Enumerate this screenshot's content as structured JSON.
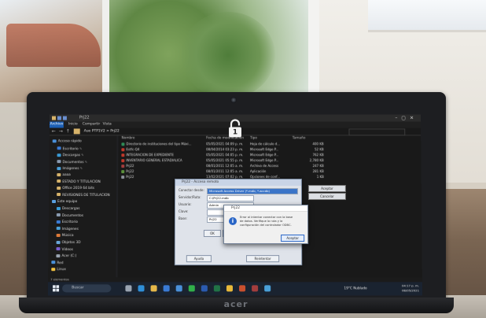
{
  "screen": {
    "window_title": "Prj22",
    "ribbon": {
      "file": "Archivo",
      "tabs": [
        "Inicio",
        "Compartir",
        "Vista"
      ]
    },
    "address_path": "Aue PTP1V2  >  Prj22",
    "nav_pane": [
      {
        "label": "Acceso rápido",
        "icon": "star-icon",
        "pinned": false
      },
      {
        "label": "Escritorio",
        "icon": "desktop-folder-icon",
        "pinned": true
      },
      {
        "label": "Descargas",
        "icon": "download-folder-icon",
        "pinned": true
      },
      {
        "label": "Documentos",
        "icon": "documents-folder-icon",
        "pinned": true
      },
      {
        "label": "Imágenes",
        "icon": "pictures-folder-icon",
        "pinned": true
      },
      {
        "label": "aaaa",
        "icon": "folder-icon",
        "pinned": false
      },
      {
        "label": "ESTADO Y TITULACION",
        "icon": "folder-icon",
        "pinned": false
      },
      {
        "label": "Office 2019 64 bits",
        "icon": "folder-icon",
        "pinned": false
      },
      {
        "label": "REVISIONES DE TITULACION",
        "icon": "folder-icon",
        "pinned": false
      },
      {
        "label": "Este equipo",
        "icon": "computer-icon",
        "pinned": false
      },
      {
        "label": "Descargas",
        "icon": "download-folder-icon",
        "pinned": false
      },
      {
        "label": "Documentos",
        "icon": "documents-folder-icon",
        "pinned": false
      },
      {
        "label": "Escritorio",
        "icon": "desktop-folder-icon",
        "pinned": false
      },
      {
        "label": "Imágenes",
        "icon": "pictures-folder-icon",
        "pinned": false
      },
      {
        "label": "Música",
        "icon": "music-folder-icon",
        "pinned": false
      },
      {
        "label": "Objetos 3D",
        "icon": "3d-objects-icon",
        "pinned": false
      },
      {
        "label": "Vídeos",
        "icon": "videos-folder-icon",
        "pinned": false
      },
      {
        "label": "Acer (C:)",
        "icon": "drive-icon",
        "pinned": false
      },
      {
        "label": "Red",
        "icon": "network-icon",
        "pinned": false
      },
      {
        "label": "Linux",
        "icon": "linux-icon",
        "pinned": false
      }
    ],
    "file_columns": [
      "Nombre",
      "Fecha de modificación",
      "Tipo",
      "Tamaño"
    ],
    "files": [
      {
        "name": "Directorio de instituciones del tipo Máxi...",
        "date": "05/05/2021 04:09 p. m.",
        "type": "Hoja de cálculo d...",
        "size": "400 KB",
        "icon_color": "#2e8b57"
      },
      {
        "name": "Estfc-Q4",
        "date": "08/04/2014 03:23 p. m.",
        "type": "Microsoft Edge P...",
        "size": "52 KB",
        "icon_color": "#c0392b"
      },
      {
        "name": "INTEGRACION DE EXPEDIENTE",
        "date": "05/05/2021 04:05 p. m.",
        "type": "Microsoft Edge P...",
        "size": "762 KB",
        "icon_color": "#c0392b"
      },
      {
        "name": "INVENTARIO GENERAL ESTADIALICA",
        "date": "05/05/2021 05:55 p. m.",
        "type": "Microsoft Edge P...",
        "size": "2,780 KB",
        "icon_color": "#c0392b"
      },
      {
        "name": "Prj22",
        "date": "08/01/2011 12:05 a. m.",
        "type": "Archivo de Access",
        "size": "247 KB",
        "icon_color": "#a33d3d"
      },
      {
        "name": "Prj22",
        "date": "08/01/2011 12:05 a. m.",
        "type": "Aplicación",
        "size": "281 KB",
        "icon_color": "#5a8f3a"
      },
      {
        "name": "Prj22",
        "date": "13/02/2021 07:02 p. m.",
        "type": "Opciones de conf...",
        "size": "1 KB",
        "icon_color": "#8a8f99"
      }
    ],
    "lock_label": "1",
    "main_dialog": {
      "title": "Prj22 - Acceso remoto",
      "rows": [
        {
          "label": "Conectar desde:",
          "value": "Microsoft Access Driver (*.mdb, *.accdb)"
        },
        {
          "label": "Servidor/Ruta:",
          "value": "C:\\Prj22.mdb"
        },
        {
          "label": "Usuario:",
          "value": "Admin"
        },
        {
          "label": "Clave:",
          "value": ""
        },
        {
          "label": "Base:",
          "value": "Prj22"
        }
      ],
      "buttons": [
        "OK",
        "Cancelar"
      ],
      "footer_buttons": [
        "Ayuda",
        "Reintentar"
      ]
    },
    "side_buttons": [
      "Aceptar",
      "Cancelar"
    ],
    "alert": {
      "title": "Prj22",
      "icon": "info-icon",
      "lines": [
        "Error al intentar conectar con la base",
        "de datos. Verifique la ruta y la",
        "configuración del controlador ODBC."
      ],
      "ok": "Aceptar"
    },
    "status_bar": "7 elementos",
    "taskbar": {
      "search_placeholder": "Buscar",
      "weather": "19°C  Nublado",
      "time": "04:17 p. m.",
      "date": "08/05/2021",
      "apps": [
        {
          "name": "task-view-icon",
          "color": "#9aa4b1"
        },
        {
          "name": "edge-icon",
          "color": "#2f8fd8"
        },
        {
          "name": "explorer-icon",
          "color": "#e6b84a"
        },
        {
          "name": "store-icon",
          "color": "#3a7bd5"
        },
        {
          "name": "mail-icon",
          "color": "#4a90d9"
        },
        {
          "name": "whatsapp-icon",
          "color": "#31b04a"
        },
        {
          "name": "word-icon",
          "color": "#2b5bb0"
        },
        {
          "name": "excel-icon",
          "color": "#217346"
        },
        {
          "name": "chrome-icon",
          "color": "#e8b93a"
        },
        {
          "name": "powerpoint-icon",
          "color": "#c9502e"
        },
        {
          "name": "access-icon",
          "color": "#a33d3d"
        },
        {
          "name": "photos-icon",
          "color": "#4aa0d8"
        }
      ]
    }
  },
  "laptop": {
    "brand": "acer"
  }
}
